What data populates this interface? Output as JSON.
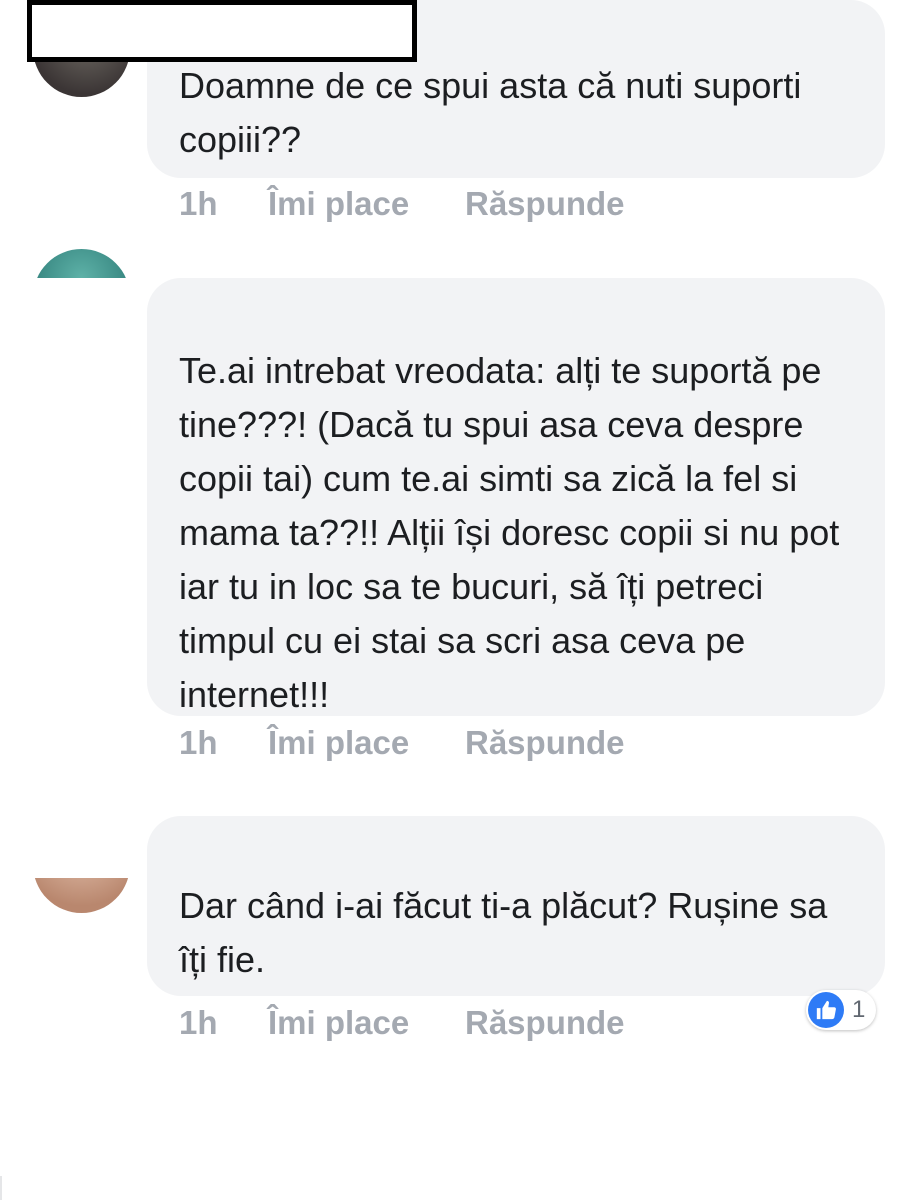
{
  "comments": [
    {
      "text": "Doamne de ce spui asta că nuti suporti copiii??",
      "time": "1h",
      "like_label": "Îmi place",
      "reply_label": "Răspunde",
      "avatar_colors": [
        "#3b3535",
        "#6e6a63"
      ]
    },
    {
      "text": "Te.ai intrebat vreodata: alți te suportă pe tine???! (Dacă tu spui asa ceva despre copii tai) cum te.ai simti sa zică la fel si mama ta??!! Alții își doresc copii si nu pot iar tu in loc sa te bucuri, să îți petreci timpul cu ei stai sa scri asa ceva pe internet!!!",
      "time": "1h",
      "like_label": "Îmi place",
      "reply_label": "Răspunde",
      "avatar_colors": [
        "#2f7d78",
        "#5eb2a8"
      ]
    },
    {
      "text": "Dar când i-ai făcut ti-a plăcut? Rușine sa îți fie.",
      "time": "1h",
      "like_label": "Îmi place",
      "reply_label": "Răspunde",
      "avatar_colors": [
        "#b9876e",
        "#e7c5b1"
      ],
      "reaction": {
        "icon": "thumbs-up-icon",
        "count": "1",
        "color": "#2e7bf6"
      }
    }
  ],
  "colors": {
    "bubble_bg": "#f2f3f5",
    "text": "#1c1e21",
    "action_text": "#a4a9b1",
    "redaction_border": "#000000"
  }
}
